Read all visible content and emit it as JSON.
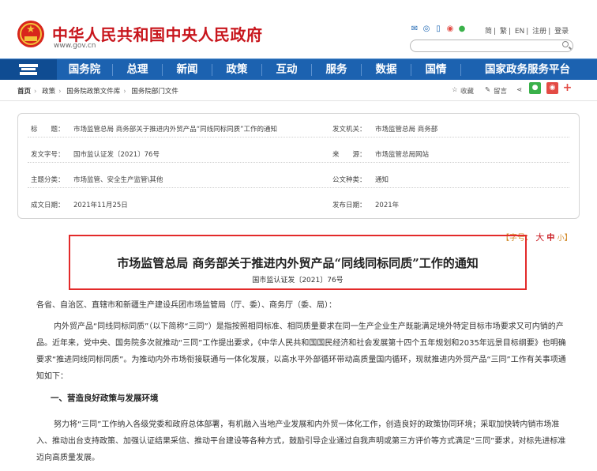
{
  "header": {
    "site_title": "中华人民共和国中央人民政府",
    "site_url": "www.gov.cn",
    "top_links": [
      "简",
      "繁",
      "EN",
      "注册",
      "登录"
    ],
    "search_placeholder": ""
  },
  "nav": {
    "items": [
      "国务院",
      "总理",
      "新闻",
      "政策",
      "互动",
      "服务",
      "数据",
      "国情",
      "国家政务服务平台"
    ]
  },
  "breadcrumb": [
    "首页",
    "政策",
    "国务院政策文件库",
    "国务院部门文件"
  ],
  "tools": {
    "favorite": "收藏",
    "comment": "留言"
  },
  "meta": {
    "rows": [
      {
        "label": "标　　题：",
        "value": "市场监管总局 商务部关于推进内外贸产品“同线同标同质”工作的通知",
        "label2": "发文机关：",
        "value2": "市场监管总局 商务部"
      },
      {
        "label": "发文字号：",
        "value": "国市监认证发〔2021〕76号",
        "label2": "来　　源：",
        "value2": "市场监管总局网站"
      },
      {
        "label": "主题分类：",
        "value": "市场监管、安全生产监管\\其他",
        "label2": "公文种类：",
        "value2": "通知"
      },
      {
        "label": "成文日期：",
        "value": "2021年11月25日",
        "label2": "发布日期：",
        "value2": "2021年"
      }
    ]
  },
  "font_size": {
    "label": "字号：",
    "large": "大",
    "medium": "中",
    "small": "小"
  },
  "document": {
    "title": "市场监管总局  商务部关于推进内外贸产品“同线同标同质”工作的通知",
    "number": "国市监认证发〔2021〕76号",
    "salutation": "各省、自治区、直辖市和新疆生产建设兵团市场监管局（厅、委）、商务厅（委、局）：",
    "para1": "内外贸产品“同线同标同质”（以下简称“三同”）是指按照相同标准、相同质量要求在同一生产企业生产既能满足境外特定目标市场要求又可内销的产品。近年来，党中央、国务院多次就推动“三同”工作提出要求，《中华人民共和国国民经济和社会发展第十四个五年规划和2035年远景目标纲要》也明确要求“推进同线同标同质”。为推动内外市场衔接联通与一体化发展，以高水平外部循环带动高质量国内循环，现就推进内外贸产品“三同”工作有关事项通知如下：",
    "heading1": "一、营造良好政策与发展环境",
    "para2": "努力将“三同”工作纳入各级党委和政府总体部署，有机融入当地产业发展和内外贸一体化工作，创造良好的政策协同环境；采取加快转内销市场准入、推动出台支持政策、加强认证结果采信、推动平台建设等各种方式，鼓励引导企业通过自我声明或第三方评价等方式满足“三同”要求，对标先进标准迈向高质量发展。"
  }
}
